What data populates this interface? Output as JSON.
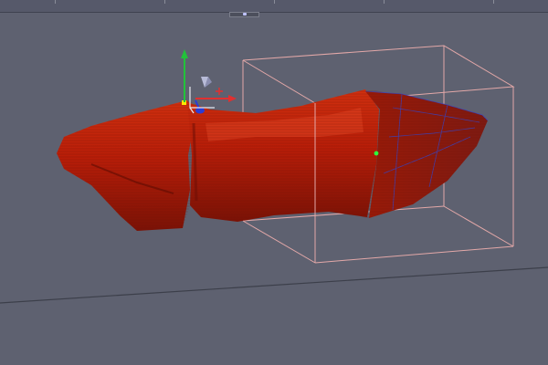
{
  "app": {
    "title": "",
    "viewport": {
      "background": "#5e6170",
      "object": {
        "color": "#c0200a",
        "highlight": "#e84a2a",
        "shadow": "#6e1006"
      },
      "bounding_box_color": "#e3a8a8",
      "gizmo": {
        "axes": [
          {
            "axis": "y",
            "color": "#22c23a"
          },
          {
            "axis": "x",
            "color": "#e03030"
          },
          {
            "axis": "z",
            "color": "#2a3cd6"
          }
        ]
      },
      "icons": [
        "translate-gizmo-icon",
        "pivot-point-icon",
        "selected-vertex-icon"
      ]
    }
  }
}
